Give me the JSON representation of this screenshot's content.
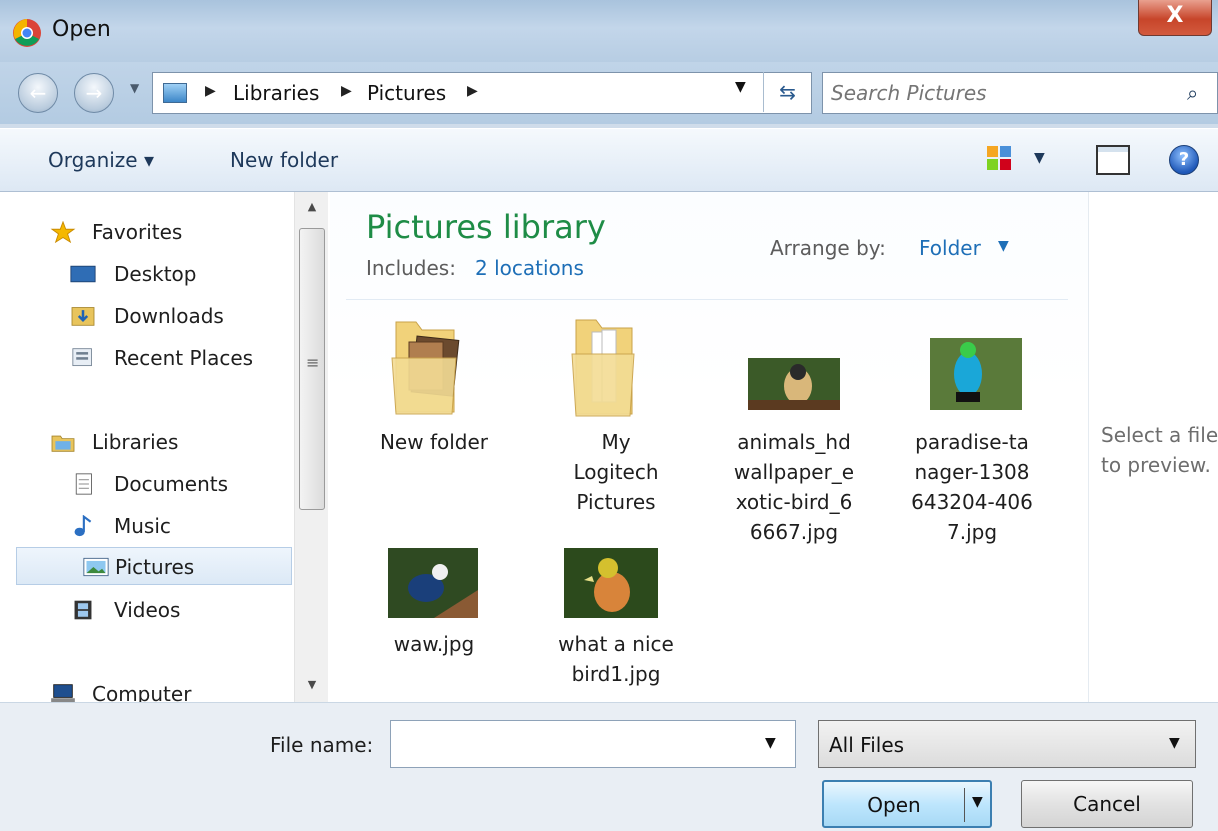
{
  "window": {
    "title": "Open",
    "close_label": "X"
  },
  "nav": {
    "back_glyph": "←",
    "forward_glyph": "→",
    "breadcrumb": [
      "Libraries",
      "Pictures"
    ],
    "refresh_glyph": "⇆"
  },
  "search": {
    "placeholder": "Search Pictures",
    "icon_glyph": "⌕"
  },
  "toolbar": {
    "organize_label": "Organize",
    "new_folder_label": "New folder",
    "help_glyph": "?"
  },
  "sidebar": {
    "favorites_label": "Favorites",
    "favorites": [
      {
        "label": "Desktop",
        "icon": "desktop-icon"
      },
      {
        "label": "Downloads",
        "icon": "downloads-icon"
      },
      {
        "label": "Recent Places",
        "icon": "recent-places-icon"
      }
    ],
    "libraries_label": "Libraries",
    "libraries": [
      {
        "label": "Documents",
        "icon": "documents-icon"
      },
      {
        "label": "Music",
        "icon": "music-icon"
      },
      {
        "label": "Pictures",
        "icon": "pictures-icon",
        "selected": true
      },
      {
        "label": "Videos",
        "icon": "videos-icon"
      }
    ],
    "computer_label": "Computer"
  },
  "content": {
    "title": "Pictures library",
    "includes_label": "Includes:",
    "includes_link": "2 locations",
    "arrange_label": "Arrange by:",
    "arrange_value": "Folder",
    "items": [
      {
        "name": "New folder",
        "type": "folder"
      },
      {
        "name": "My\nLogitech\nPictures",
        "type": "folder"
      },
      {
        "name": "animals_hd\nwallpaper_e\nxotic-bird_6\n6667.jpg",
        "type": "image"
      },
      {
        "name": "paradise-ta\nnager-1308\n643204-406\n7.jpg",
        "type": "image"
      },
      {
        "name": "waw.jpg",
        "type": "image"
      },
      {
        "name": "what a nice\nbird1.jpg",
        "type": "image"
      }
    ]
  },
  "preview": {
    "text": "Select a file\nto preview."
  },
  "bottom": {
    "file_name_label": "File name:",
    "file_name_value": "",
    "file_type_value": "All Files",
    "open_label": "Open",
    "cancel_label": "Cancel"
  },
  "colors": {
    "library_title": "#1e8c46",
    "link": "#1e6fb7",
    "selection": "#dce9f6"
  }
}
